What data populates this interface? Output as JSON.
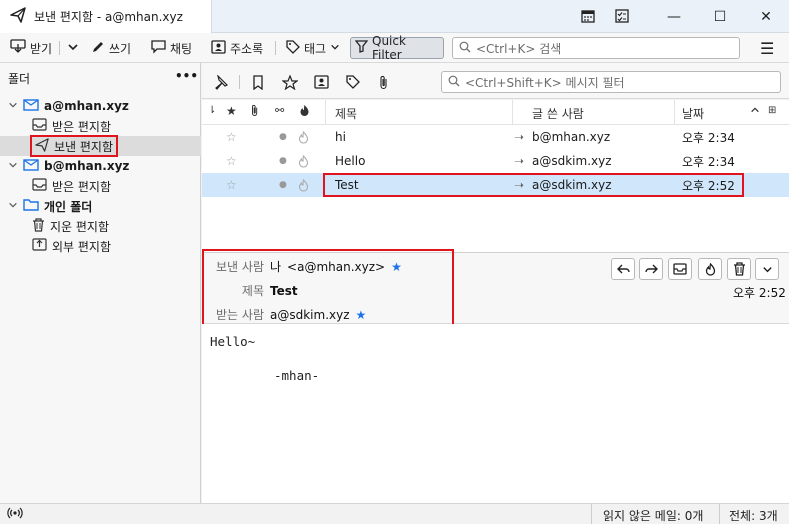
{
  "window": {
    "tab_title": "보낸 편지함 - a@mhan.xyz",
    "min": "—",
    "max": "☐",
    "close": "✕"
  },
  "toolbar": {
    "get": "받기",
    "write": "쓰기",
    "chat": "채팅",
    "address_book": "주소록",
    "tag": "태그",
    "quick_filter": "Quick Filter",
    "search_placeholder": "<Ctrl+K> 검색",
    "menu": "☰"
  },
  "folders": {
    "header": "폴더",
    "more": "•••",
    "accounts": [
      {
        "name": "a@mhan.xyz",
        "items": [
          "받은 편지함",
          "보낸 편지함"
        ]
      },
      {
        "name": "b@mhan.xyz",
        "items": [
          "받은 편지함"
        ]
      },
      {
        "name": "개인 폴더",
        "items": [
          "지운 편지함",
          "외부 편지함"
        ]
      }
    ]
  },
  "message_toolbar": {
    "filter_placeholder": "<Ctrl+Shift+K> 메시지 필터"
  },
  "thread_columns": {
    "subject": "제목",
    "author": "글 쓴 사람",
    "date": "날짜"
  },
  "messages": [
    {
      "subject": "hi",
      "recipient": "b@mhan.xyz",
      "date": "오후 2:34",
      "selected": false
    },
    {
      "subject": "Hello",
      "recipient": "a@sdkim.xyz",
      "date": "오후 2:34",
      "selected": false
    },
    {
      "subject": "Test",
      "recipient": "a@sdkim.xyz",
      "date": "오후 2:52",
      "selected": true
    }
  ],
  "header": {
    "from_label": "보낸 사람",
    "from_name": "나",
    "from_email": "<a@mhan.xyz>",
    "subject_label": "제목",
    "subject": "Test",
    "to_label": "받는 사람",
    "to": "a@sdkim.xyz",
    "date": "오후 2:52"
  },
  "body": {
    "line1": "Hello~",
    "line2": "-mhan-"
  },
  "status": {
    "unread": "읽지 않은 메일: 0개",
    "total": "전체: 3개"
  },
  "colors": {
    "selection": "#cfe6fb",
    "highlight_border": "#e0141e",
    "accent": "#1a73e8"
  }
}
